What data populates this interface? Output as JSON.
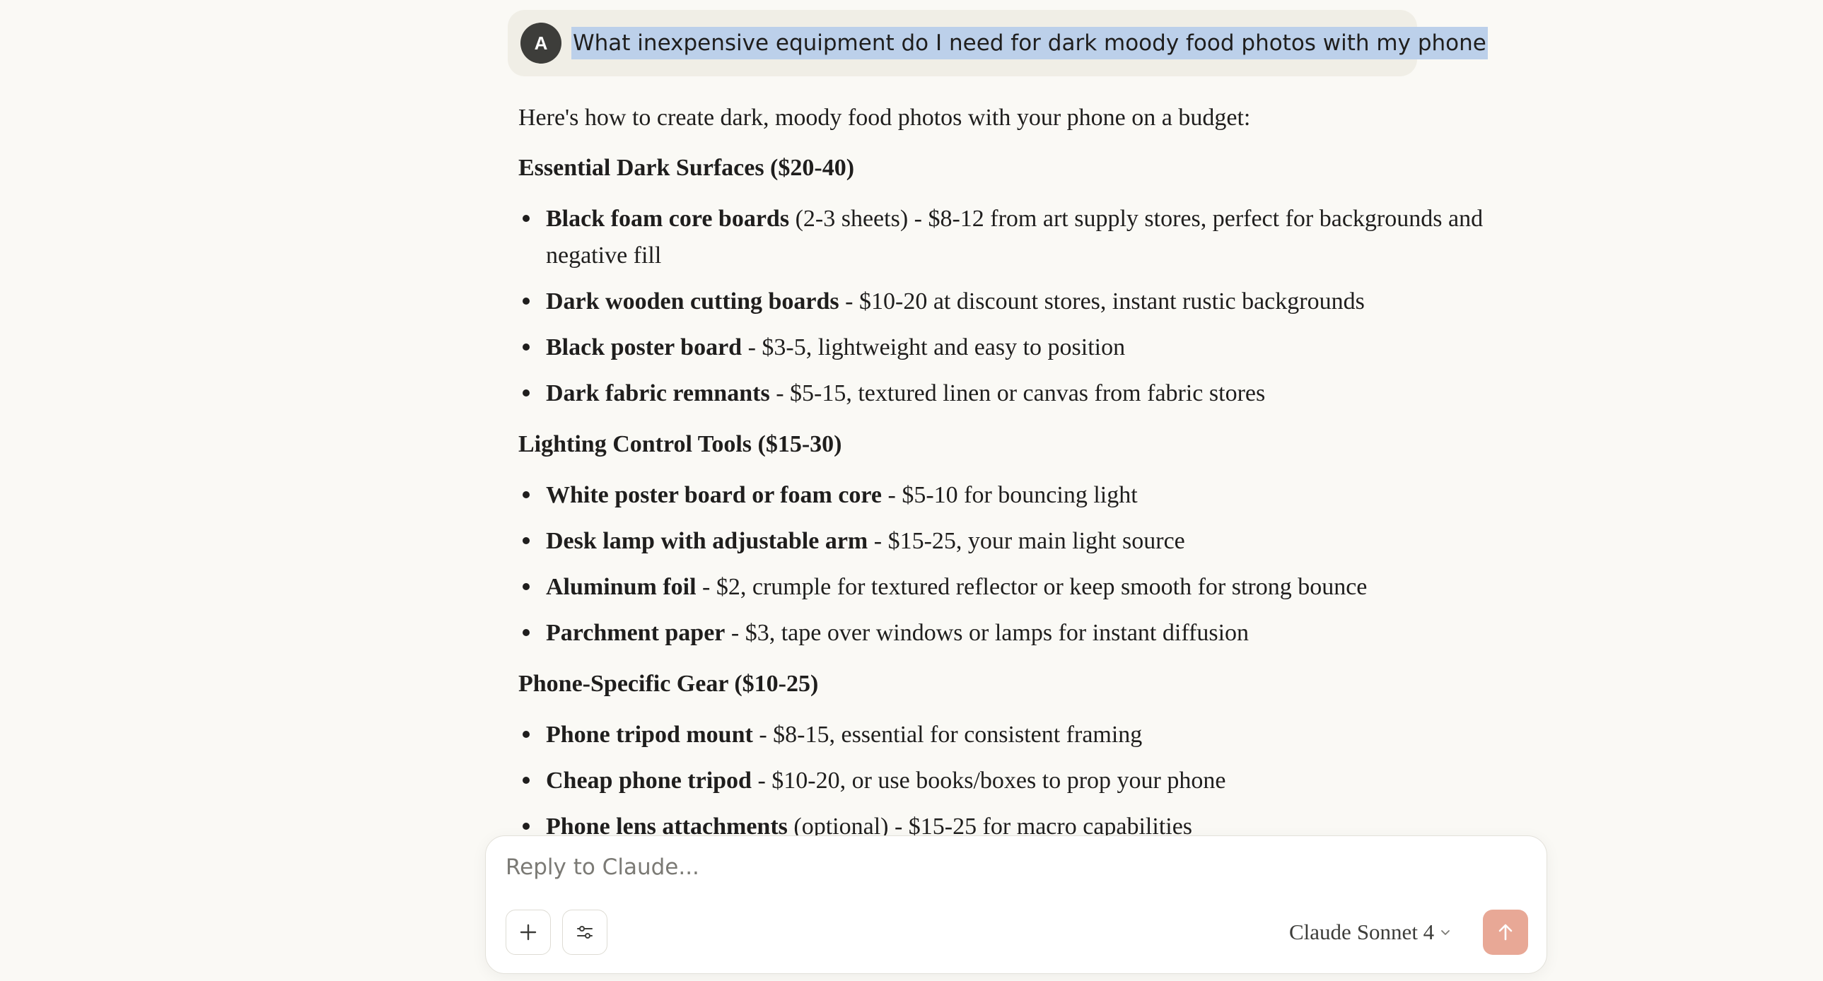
{
  "user_message": {
    "avatar_initial": "A",
    "text": "What inexpensive equipment do I need for dark moody food photos with my phone"
  },
  "response": {
    "intro": "Here's how to create dark, moody food photos with your phone on a budget:",
    "sections": [
      {
        "heading": "Essential Dark Surfaces ($20-40)",
        "items": [
          {
            "bold": "Black foam core boards",
            "rest": " (2-3 sheets) - $8-12 from art supply stores, perfect for backgrounds and negative fill"
          },
          {
            "bold": "Dark wooden cutting boards",
            "rest": " - $10-20 at discount stores, instant rustic backgrounds"
          },
          {
            "bold": "Black poster board",
            "rest": " - $3-5, lightweight and easy to position"
          },
          {
            "bold": "Dark fabric remnants",
            "rest": " - $5-15, textured linen or canvas from fabric stores"
          }
        ]
      },
      {
        "heading": "Lighting Control Tools ($15-30)",
        "items": [
          {
            "bold": "White poster board or foam core",
            "rest": " - $5-10 for bouncing light"
          },
          {
            "bold": "Desk lamp with adjustable arm",
            "rest": " - $15-25, your main light source"
          },
          {
            "bold": "Aluminum foil",
            "rest": " - $2, crumple for textured reflector or keep smooth for strong bounce"
          },
          {
            "bold": "Parchment paper",
            "rest": " - $3, tape over windows or lamps for instant diffusion"
          }
        ]
      },
      {
        "heading": "Phone-Specific Gear ($10-25)",
        "items": [
          {
            "bold": "Phone tripod mount",
            "rest": " - $8-15, essential for consistent framing"
          },
          {
            "bold": "Cheap phone tripod",
            "rest": " - $10-20, or use books/boxes to prop your phone"
          },
          {
            "bold": "Phone lens attachments",
            "rest": " (optional) - $15-25 for macro capabilities"
          }
        ]
      }
    ]
  },
  "composer": {
    "placeholder": "Reply to Claude...",
    "add_icon": "plus-icon",
    "tools_icon": "sliders-icon",
    "model_brand": "Claude",
    "model_name": "Sonnet 4",
    "send_icon": "arrow-up-icon",
    "send_color": "#e8a896"
  }
}
